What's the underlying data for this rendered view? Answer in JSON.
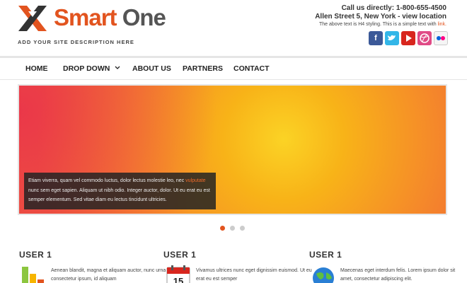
{
  "brand": {
    "part1": "Smart",
    "part2": "One",
    "description": "ADD YOUR SITE DESCRIPTION HERE"
  },
  "contact": {
    "line1": "Call us directly: 1-800-655-4500",
    "line2": "Allen Street 5, New York - view location",
    "line3": "The above text is H4 styling. This is a simple text with",
    "link": "link."
  },
  "social": [
    "facebook-icon",
    "twitter-icon",
    "youtube-icon",
    "dribbble-icon",
    "flickr-icon"
  ],
  "nav": {
    "home": "HOME",
    "dropdown": "DROP DOWN",
    "about": "ABOUT US",
    "partners": "PARTNERS",
    "contact": "CONTACT"
  },
  "slider": {
    "caption_before": "Etiam viverra, quam vel commodo luctus, dolor lectus molestie leo, nec",
    "caption_highlight": "vulputate",
    "caption_after": "nunc sem eget sapien. Aliquam ut nibh odio. Integer auctor, dolor. Ut eu erat eu est semper elementum. Sed vitae diam eu lectus tincidunt ultricies.",
    "slide_count": 3,
    "active_slide": 1
  },
  "columns": [
    {
      "title": "USER 1",
      "text": "Aenean blandit, magna et aliquam auctor, nunc urna consectetur ipsum, id aliquam",
      "icon": "bar-chart-icon"
    },
    {
      "title": "USER 1",
      "text": "Vivamus ultrices nunc eget dignissim euismod. Ut eu erat eu est semper",
      "icon": "calendar-icon",
      "calendar_day": "15"
    },
    {
      "title": "USER 1",
      "text": "Maecenas eget interdum felis. Lorem ipsum dolor sit amet, consectetur adipiscing elit.",
      "icon": "globe-icon"
    }
  ],
  "colors": {
    "accent": "#e2541f",
    "nav_text": "#222222"
  }
}
